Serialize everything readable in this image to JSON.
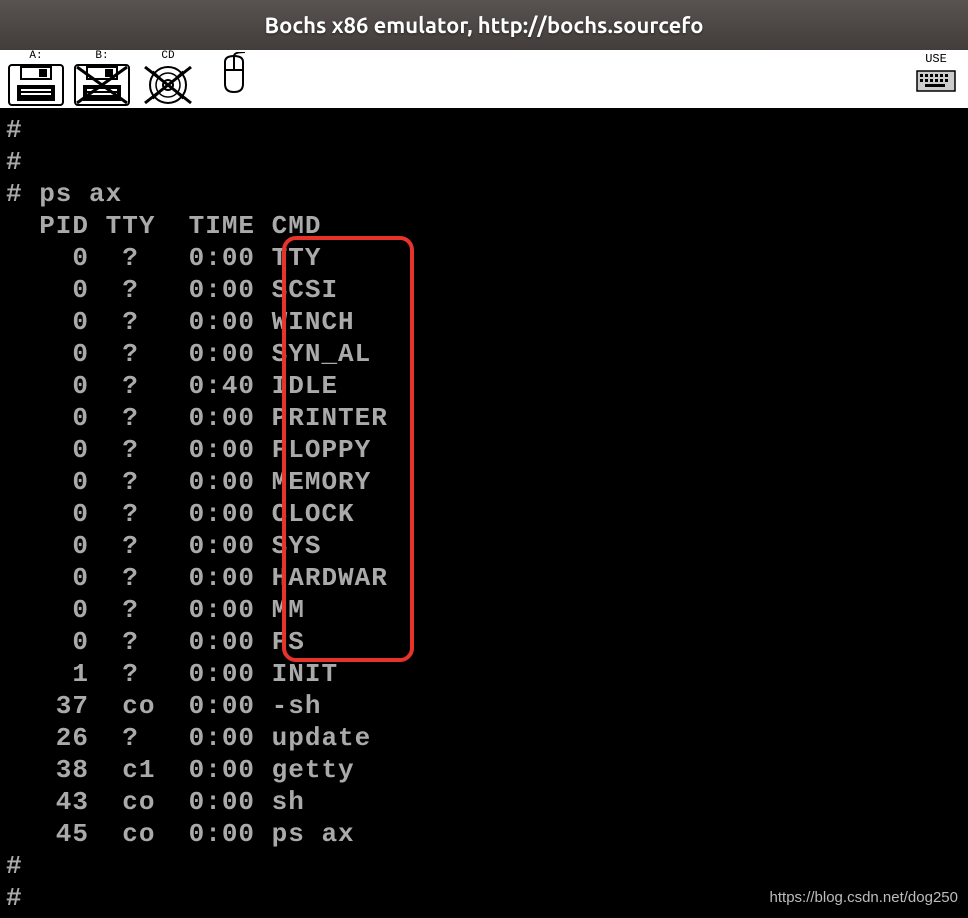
{
  "window": {
    "title": "Bochs x86 emulator, http://bochs.sourcefo"
  },
  "toolbar": {
    "drives": [
      {
        "label": "A:",
        "type": "floppy",
        "enabled": true
      },
      {
        "label": "B:",
        "type": "floppy",
        "enabled": false
      },
      {
        "label": "CD",
        "type": "cd",
        "enabled": false
      },
      {
        "label": "",
        "type": "mouse",
        "enabled": true
      }
    ],
    "usb_label": "USE"
  },
  "terminal": {
    "prompt_blank_lines": 2,
    "command": "ps ax",
    "header": {
      "pid": "PID",
      "tty": "TTY",
      "time": "TIME",
      "cmd": "CMD"
    },
    "rows": [
      {
        "pid": "0",
        "tty": "?",
        "time": "0:00",
        "cmd": "TTY",
        "hl": true
      },
      {
        "pid": "0",
        "tty": "?",
        "time": "0:00",
        "cmd": "SCSI",
        "hl": true
      },
      {
        "pid": "0",
        "tty": "?",
        "time": "0:00",
        "cmd": "WINCH",
        "hl": true
      },
      {
        "pid": "0",
        "tty": "?",
        "time": "0:00",
        "cmd": "SYN_AL",
        "hl": true
      },
      {
        "pid": "0",
        "tty": "?",
        "time": "0:40",
        "cmd": "IDLE",
        "hl": true
      },
      {
        "pid": "0",
        "tty": "?",
        "time": "0:00",
        "cmd": "PRINTER",
        "hl": true
      },
      {
        "pid": "0",
        "tty": "?",
        "time": "0:00",
        "cmd": "FLOPPY",
        "hl": true
      },
      {
        "pid": "0",
        "tty": "?",
        "time": "0:00",
        "cmd": "MEMORY",
        "hl": true
      },
      {
        "pid": "0",
        "tty": "?",
        "time": "0:00",
        "cmd": "CLOCK",
        "hl": true
      },
      {
        "pid": "0",
        "tty": "?",
        "time": "0:00",
        "cmd": "SYS",
        "hl": true
      },
      {
        "pid": "0",
        "tty": "?",
        "time": "0:00",
        "cmd": "HARDWAR",
        "hl": true
      },
      {
        "pid": "0",
        "tty": "?",
        "time": "0:00",
        "cmd": "MM",
        "hl": true
      },
      {
        "pid": "0",
        "tty": "?",
        "time": "0:00",
        "cmd": "FS",
        "hl": true
      },
      {
        "pid": "1",
        "tty": "?",
        "time": "0:00",
        "cmd": "INIT",
        "hl": false
      },
      {
        "pid": "37",
        "tty": "co",
        "time": "0:00",
        "cmd": "-sh",
        "hl": false
      },
      {
        "pid": "26",
        "tty": "?",
        "time": "0:00",
        "cmd": "update",
        "hl": false
      },
      {
        "pid": "38",
        "tty": "c1",
        "time": "0:00",
        "cmd": "getty",
        "hl": false
      },
      {
        "pid": "43",
        "tty": "co",
        "time": "0:00",
        "cmd": "sh",
        "hl": false
      },
      {
        "pid": "45",
        "tty": "co",
        "time": "0:00",
        "cmd": "ps ax",
        "hl": false
      }
    ],
    "trailing_blank_prompts": 2
  },
  "annotation": {
    "watermark": "https://blog.csdn.net/dog250",
    "highlight_color": "#e8332a"
  }
}
